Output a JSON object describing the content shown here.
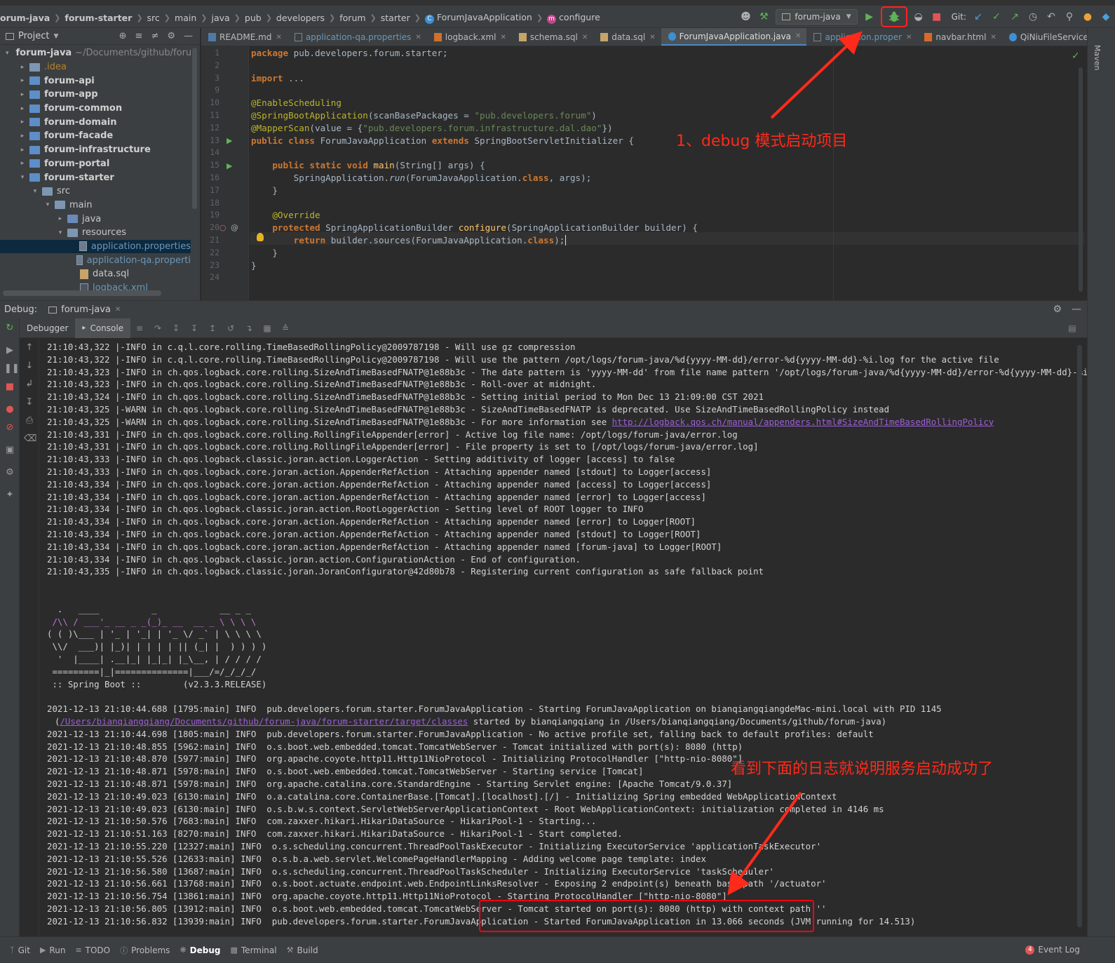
{
  "navbar": {
    "crumbs": [
      "orum-java",
      "forum-starter",
      "src",
      "main",
      "java",
      "pub",
      "developers",
      "forum",
      "starter",
      "ForumJavaApplication",
      "configure"
    ],
    "run_config": "forum-java",
    "git_label": "Git:"
  },
  "project": {
    "title": "Project",
    "tree": [
      {
        "label": "forum-java",
        "hint": "~/Documents/github/foru",
        "indent": 0,
        "kind": "root",
        "open": true
      },
      {
        "label": ".idea",
        "indent": 1,
        "kind": "idea"
      },
      {
        "label": "forum-api",
        "indent": 1,
        "kind": "module"
      },
      {
        "label": "forum-app",
        "indent": 1,
        "kind": "module"
      },
      {
        "label": "forum-common",
        "indent": 1,
        "kind": "module"
      },
      {
        "label": "forum-domain",
        "indent": 1,
        "kind": "module"
      },
      {
        "label": "forum-facade",
        "indent": 1,
        "kind": "module"
      },
      {
        "label": "forum-infrastructure",
        "indent": 1,
        "kind": "module"
      },
      {
        "label": "forum-portal",
        "indent": 1,
        "kind": "module"
      },
      {
        "label": "forum-starter",
        "indent": 1,
        "kind": "module",
        "open": true
      },
      {
        "label": "src",
        "indent": 2,
        "kind": "folder",
        "open": true
      },
      {
        "label": "main",
        "indent": 3,
        "kind": "folder",
        "open": true
      },
      {
        "label": "java",
        "indent": 4,
        "kind": "src"
      },
      {
        "label": "resources",
        "indent": 4,
        "kind": "folder",
        "open": true
      },
      {
        "label": "application.properties",
        "indent": 5,
        "kind": "prop",
        "selected": true
      },
      {
        "label": "application-qa.properti",
        "indent": 5,
        "kind": "prop"
      },
      {
        "label": "data.sql",
        "indent": 5,
        "kind": "sql"
      },
      {
        "label": "logback.xml",
        "indent": 5,
        "kind": "xml"
      }
    ]
  },
  "tabs": [
    {
      "label": "README.md",
      "icon": "md"
    },
    {
      "label": "application-qa.properties",
      "icon": "p",
      "prop": true
    },
    {
      "label": "logback.xml",
      "icon": "x"
    },
    {
      "label": "schema.sql",
      "icon": "s"
    },
    {
      "label": "data.sql",
      "icon": "s"
    },
    {
      "label": "ForumJavaApplication.java",
      "icon": "j",
      "active": true
    },
    {
      "label": "application.proper",
      "icon": "p",
      "prop": true
    },
    {
      "label": "navbar.html",
      "icon": "h"
    },
    {
      "label": "QiNiuFileServiceImpl.java",
      "icon": "j"
    }
  ],
  "editor": {
    "line_numbers": [
      "1",
      "2",
      "3",
      "9",
      "10",
      "11",
      "12",
      "13",
      "14",
      "15",
      "16",
      "17",
      "18",
      "19",
      "20",
      "21",
      "22",
      "23",
      "24"
    ],
    "lines": [
      "<span class=\"kw\">package</span> pub.developers.forum.starter;",
      "",
      "<span class=\"kw\">import</span> ...",
      "",
      "<span class=\"an\">@EnableScheduling</span>",
      "<span class=\"an\">@SpringBootApplication</span>(scanBasePackages = <span class=\"st\">\"pub.developers.forum\"</span>)",
      "<span class=\"an\">@MapperScan</span>(value = {<span class=\"st\">\"pub.developers.forum.infrastructure.dal.dao\"</span>})",
      "<span class=\"kw\">public class</span> ForumJavaApplication <span class=\"kw\">extends</span> SpringBootServletInitializer {",
      "",
      "    <span class=\"kw\">public static void</span> <span class=\"fn\">main</span>(String[] args) {",
      "        SpringApplication.<i>run</i>(ForumJavaApplication.<span class=\"kw\">class</span>, args);",
      "    }",
      "",
      "    <span class=\"an\">@Override</span>",
      "    <span class=\"kw\">protected</span> SpringApplicationBuilder <span class=\"fn\">configure</span>(SpringApplicationBuilder builder) {",
      "        <span class=\"kw\">return</span> builder.sources(ForumJavaApplication.<span class=\"kw\">class</span>);",
      "    }",
      "}",
      ""
    ]
  },
  "debug": {
    "label": "Debug:",
    "session": "forum-java",
    "subtabs": [
      "Debugger",
      "Console"
    ]
  },
  "console": {
    "lines": [
      "21:10:43,322 |-INFO in c.q.l.core.rolling.TimeBasedRollingPolicy@2009787198 - Will use gz compression",
      "21:10:43,322 |-INFO in c.q.l.core.rolling.TimeBasedRollingPolicy@2009787198 - Will use the pattern /opt/logs/forum-java/%d{yyyy-MM-dd}/error-%d{yyyy-MM-dd}-%i.log for the active file",
      "21:10:43,323 |-INFO in ch.qos.logback.core.rolling.SizeAndTimeBasedFNATP@1e88b3c - The date pattern is 'yyyy-MM-dd' from file name pattern '/opt/logs/forum-java/%d{yyyy-MM-dd}/error-%d{yyyy-MM-dd}-%i.log.gz'.",
      "21:10:43,323 |-INFO in ch.qos.logback.core.rolling.SizeAndTimeBasedFNATP@1e88b3c - Roll-over at midnight.",
      "21:10:43,324 |-INFO in ch.qos.logback.core.rolling.SizeAndTimeBasedFNATP@1e88b3c - Setting initial period to Mon Dec 13 21:09:00 CST 2021",
      "21:10:43,325 |-WARN in ch.qos.logback.core.rolling.SizeAndTimeBasedFNATP@1e88b3c - SizeAndTimeBasedFNATP is deprecated. Use SizeAndTimeBasedRollingPolicy instead",
      "21:10:43,325 |-WARN in ch.qos.logback.core.rolling.SizeAndTimeBasedFNATP@1e88b3c - For more information see ",
      "21:10:43,331 |-INFO in ch.qos.logback.core.rolling.RollingFileAppender[error] - Active log file name: /opt/logs/forum-java/error.log",
      "21:10:43,331 |-INFO in ch.qos.logback.core.rolling.RollingFileAppender[error] - File property is set to [/opt/logs/forum-java/error.log]",
      "21:10:43,333 |-INFO in ch.qos.logback.classic.joran.action.LoggerAction - Setting additivity of logger [access] to false",
      "21:10:43,333 |-INFO in ch.qos.logback.core.joran.action.AppenderRefAction - Attaching appender named [stdout] to Logger[access]",
      "21:10:43,334 |-INFO in ch.qos.logback.core.joran.action.AppenderRefAction - Attaching appender named [access] to Logger[access]",
      "21:10:43,334 |-INFO in ch.qos.logback.core.joran.action.AppenderRefAction - Attaching appender named [error] to Logger[access]",
      "21:10:43,334 |-INFO in ch.qos.logback.classic.joran.action.RootLoggerAction - Setting level of ROOT logger to INFO",
      "21:10:43,334 |-INFO in ch.qos.logback.core.joran.action.AppenderRefAction - Attaching appender named [error] to Logger[ROOT]",
      "21:10:43,334 |-INFO in ch.qos.logback.core.joran.action.AppenderRefAction - Attaching appender named [stdout] to Logger[ROOT]",
      "21:10:43,334 |-INFO in ch.qos.logback.core.joran.action.AppenderRefAction - Attaching appender named [forum-java] to Logger[ROOT]",
      "21:10:43,334 |-INFO in ch.qos.logback.classic.joran.action.ConfigurationAction - End of configuration.",
      "21:10:43,335 |-INFO in ch.qos.logback.classic.joran.JoranConfigurator@42d80b78 - Registering current configuration as safe fallback point"
    ],
    "link": "http://logback.qos.ch/manual/appenders.html#SizeAndTimeBasedRollingPolicy",
    "banner": [
      "  .   ____          _            __ _ _",
      " /\\\\ / ___'_ __ _ _(_)_ __  __ _ \\ \\ \\ \\",
      "( ( )\\___ | '_ | '_| | '_ \\/ _` | \\ \\ \\ \\",
      " \\\\/  ___)| |_)| | | | | || (_| |  ) ) ) )",
      "  '  |____| .__|_| |_|_| |_\\__, | / / / /",
      " =========|_|==============|___/=/_/_/_/",
      " :: Spring Boot ::        (v2.3.3.RELEASE)"
    ],
    "spring_lines": [
      "2021-12-13 21:10:44.688 [1795:main] INFO  pub.developers.forum.starter.ForumJavaApplication - Starting ForumJavaApplication on bianqiangqiangdeMac-mini.local with PID 1145",
      "2021-12-13 21:10:44.698 [1805:main] INFO  pub.developers.forum.starter.ForumJavaApplication - No active profile set, falling back to default profiles: default",
      "2021-12-13 21:10:48.855 [5962:main] INFO  o.s.boot.web.embedded.tomcat.TomcatWebServer - Tomcat initialized with port(s): 8080 (http)",
      "2021-12-13 21:10:48.870 [5977:main] INFO  org.apache.coyote.http11.Http11NioProtocol - Initializing ProtocolHandler [\"http-nio-8080\"]",
      "2021-12-13 21:10:48.871 [5978:main] INFO  o.s.boot.web.embedded.tomcat.TomcatWebServer - Starting service [Tomcat]",
      "2021-12-13 21:10:48.871 [5978:main] INFO  org.apache.catalina.core.StandardEngine - Starting Servlet engine: [Apache Tomcat/9.0.37]",
      "2021-12-13 21:10:49.023 [6130:main] INFO  o.a.catalina.core.ContainerBase.[Tomcat].[localhost].[/] - Initializing Spring embedded WebApplicationContext",
      "2021-12-13 21:10:49.023 [6130:main] INFO  o.s.b.w.s.context.ServletWebServerApplicationContext - Root WebApplicationContext: initialization completed in 4146 ms",
      "2021-12-13 21:10:50.576 [7683:main] INFO  com.zaxxer.hikari.HikariDataSource - HikariPool-1 - Starting...",
      "2021-12-13 21:10:51.163 [8270:main] INFO  com.zaxxer.hikari.HikariDataSource - HikariPool-1 - Start completed.",
      "2021-12-13 21:10:55.220 [12327:main] INFO  o.s.scheduling.concurrent.ThreadPoolTaskExecutor - Initializing ExecutorService 'applicationTaskExecutor'",
      "2021-12-13 21:10:55.526 [12633:main] INFO  o.s.b.a.web.servlet.WelcomePageHandlerMapping - Adding welcome page template: index",
      "2021-12-13 21:10:56.580 [13687:main] INFO  o.s.scheduling.concurrent.ThreadPoolTaskScheduler - Initializing ExecutorService 'taskScheduler'",
      "2021-12-13 21:10:56.661 [13768:main] INFO  o.s.boot.actuate.endpoint.web.EndpointLinksResolver - Exposing 2 endpoint(s) beneath base path '/actuator'",
      "2021-12-13 21:10:56.754 [13861:main] INFO  org.apache.coyote.http11.Http11NioProtocol - Starting ProtocolHandler [\"http-nio-8080\"]",
      "2021-12-13 21:10:56.805 [13912:main] INFO  o.s.boot.web.embedded.tomcat.TomcatWebServer - Tomcat started on port(s): 8080 (http) with context path ''",
      "2021-12-13 21:10:56.832 [13939:main] INFO  pub.developers.forum.starter.ForumJavaApplication - Started ForumJavaApplication in 13.066 seconds (JVM running for 14.513)"
    ],
    "classpath_link": "/Users/bianqiangqiang/Documents/github/forum-java/forum-starter/target/classes",
    "classpath_rest": " started by bianqiangqiang in /Users/bianqiangqiang/Documents/github/forum-java)"
  },
  "annotations": {
    "debug_note": "1、debug 模式启动项目",
    "log_note": "看到下面的日志就说明服务启动成功了",
    "color": "#ff2a1a"
  },
  "statusbar": {
    "items": [
      "Git",
      "Run",
      "TODO",
      "Problems",
      "Debug",
      "Terminal",
      "Build"
    ],
    "event_log": "Event Log",
    "event_count": "4"
  },
  "maven_label": "Maven"
}
